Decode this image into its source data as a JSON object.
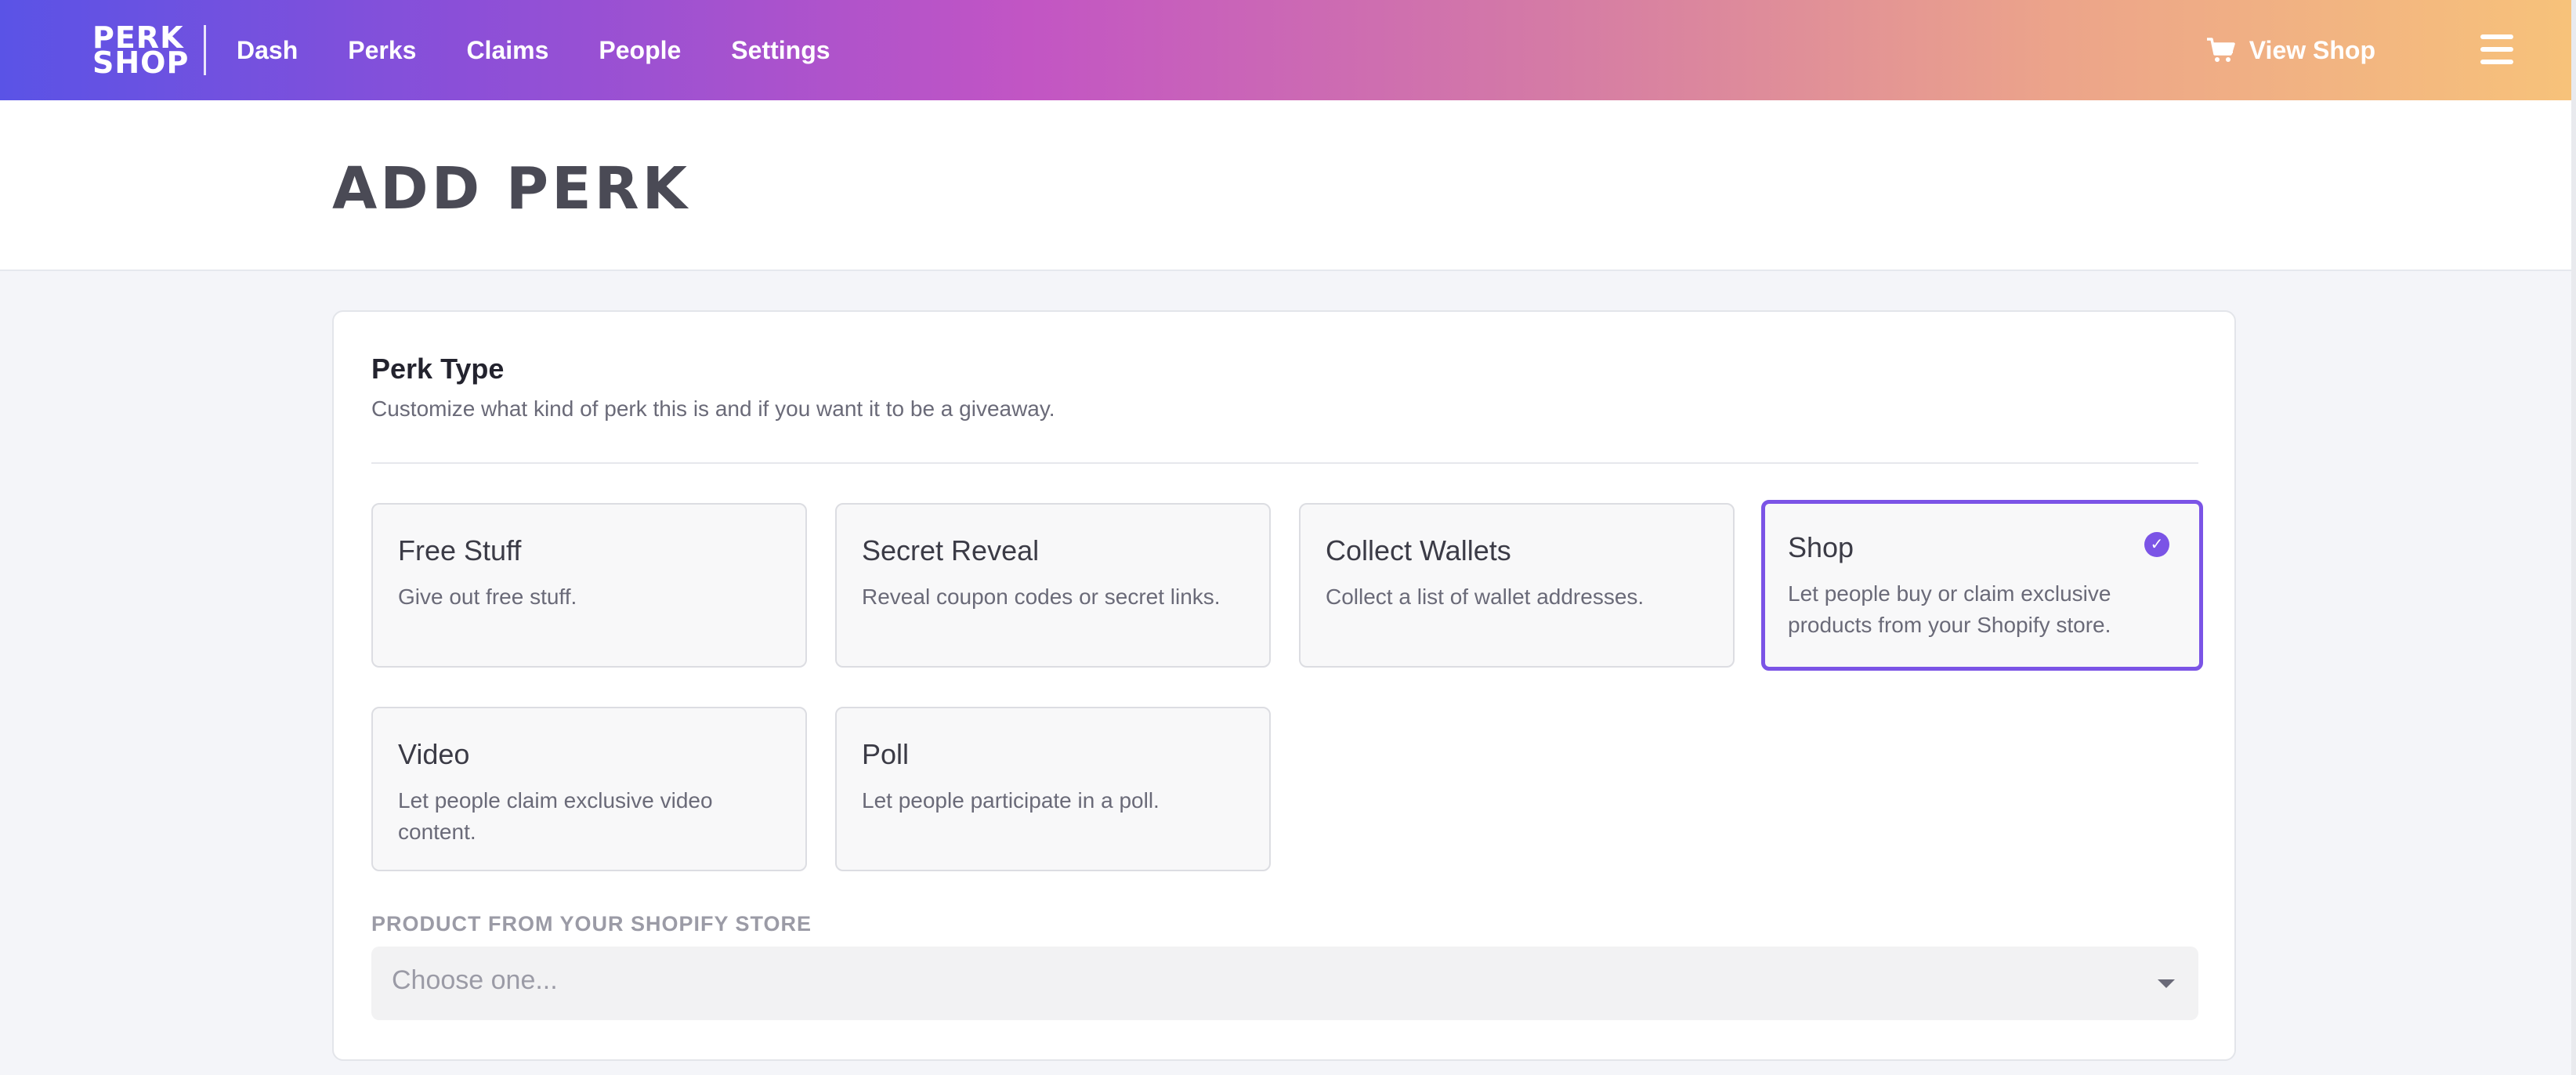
{
  "brand": {
    "logo_line1": "PERK",
    "logo_line2": "SHOP"
  },
  "nav": {
    "items": [
      "Dash",
      "Perks",
      "Claims",
      "People",
      "Settings"
    ]
  },
  "header": {
    "view_shop_label": "View Shop"
  },
  "page": {
    "title": "ADD PERK"
  },
  "perk_type": {
    "title": "Perk Type",
    "description": "Customize what kind of perk this is and if you want it to be a giveaway.",
    "options": [
      {
        "title": "Free Stuff",
        "description": "Give out free stuff.",
        "selected": false
      },
      {
        "title": "Secret Reveal",
        "description": "Reveal coupon codes or secret links.",
        "selected": false
      },
      {
        "title": "Collect Wallets",
        "description": "Collect a list of wallet addresses.",
        "selected": false
      },
      {
        "title": "Shop",
        "description": "Let people buy or claim exclusive products from your Shopify store.",
        "selected": true
      },
      {
        "title": "Video",
        "description": "Let people claim exclusive video content.",
        "selected": false
      },
      {
        "title": "Poll",
        "description": "Let people participate in a poll.",
        "selected": false
      }
    ]
  },
  "product_field": {
    "label": "PRODUCT FROM YOUR SHOPIFY STORE",
    "placeholder": "Choose one..."
  },
  "colors": {
    "accent": "#7b54e6",
    "gradient_start": "#5a53e6",
    "gradient_mid": "#c255c4",
    "gradient_end": "#f7c27a"
  }
}
